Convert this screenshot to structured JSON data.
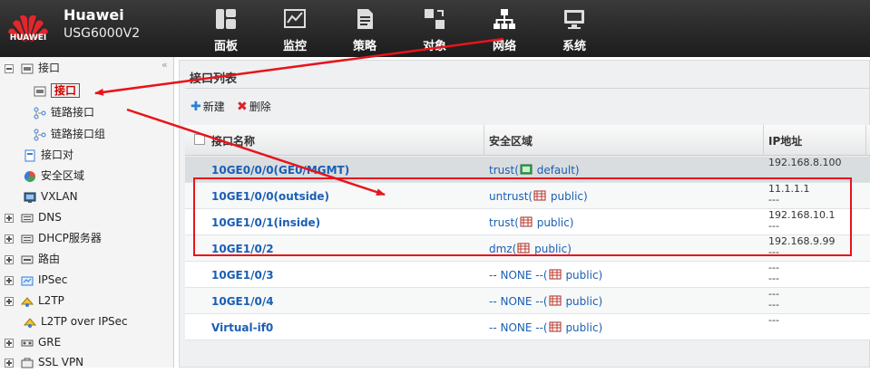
{
  "header": {
    "logo_text": "HUAWEI",
    "brand": "Huawei",
    "model": "USG6000V2",
    "nav": [
      {
        "label": "面板",
        "icon": "dashboard-icon"
      },
      {
        "label": "监控",
        "icon": "monitor-icon"
      },
      {
        "label": "策略",
        "icon": "policy-icon"
      },
      {
        "label": "对象",
        "icon": "object-icon"
      },
      {
        "label": "网络",
        "icon": "network-icon"
      },
      {
        "label": "系统",
        "icon": "system-icon"
      }
    ]
  },
  "sidebar": {
    "collapse_glyph": "«",
    "items": [
      {
        "label": "接口",
        "icon": "interface-icon",
        "expander": "minus"
      },
      {
        "label": "接口",
        "icon": "interface-icon",
        "selected": true
      },
      {
        "label": "链路接口",
        "icon": "link-interface-icon"
      },
      {
        "label": "链路接口组",
        "icon": "link-group-icon"
      },
      {
        "label": "接口对",
        "icon": "interface-pair-icon"
      },
      {
        "label": "安全区域",
        "icon": "security-zone-icon"
      },
      {
        "label": "VXLAN",
        "icon": "vxlan-icon"
      },
      {
        "label": "DNS",
        "icon": "dns-icon",
        "expander": "plus"
      },
      {
        "label": "DHCP服务器",
        "icon": "dhcp-icon",
        "expander": "plus"
      },
      {
        "label": "路由",
        "icon": "route-icon",
        "expander": "plus"
      },
      {
        "label": "IPSec",
        "icon": "ipsec-icon",
        "expander": "plus"
      },
      {
        "label": "L2TP",
        "icon": "l2tp-icon",
        "expander": "plus"
      },
      {
        "label": "L2TP over IPSec",
        "icon": "l2tp-ipsec-icon"
      },
      {
        "label": "GRE",
        "icon": "gre-icon",
        "expander": "plus"
      },
      {
        "label": "SSL VPN",
        "icon": "sslvpn-icon",
        "expander": "plus"
      }
    ]
  },
  "main": {
    "panel_title": "接口列表",
    "toolbar": {
      "new_label": "新建",
      "new_icon": "plus-icon",
      "delete_label": "删除",
      "delete_icon": "delete-icon"
    },
    "columns": [
      "接口名称",
      "安全区域",
      "IP地址"
    ],
    "rows": [
      {
        "name": "10GE0/0/0(GE0/MGMT)",
        "zone_prefix": "trust(",
        "zone_icon": "zone-green-icon",
        "zone_suffix": " default)",
        "ip": [
          "192.168.8.100",
          ""
        ]
      },
      {
        "name": "10GE1/0/0(outside)",
        "zone_prefix": "untrust(",
        "zone_icon": "zone-red-icon",
        "zone_suffix": " public)",
        "ip": [
          "11.1.1.1",
          "---"
        ]
      },
      {
        "name": "10GE1/0/1(inside)",
        "zone_prefix": "trust(",
        "zone_icon": "zone-red-icon",
        "zone_suffix": " public)",
        "ip": [
          "192.168.10.1",
          "---"
        ]
      },
      {
        "name": "10GE1/0/2",
        "zone_prefix": "dmz(",
        "zone_icon": "zone-red-icon",
        "zone_suffix": " public)",
        "ip": [
          "192.168.9.99",
          "---"
        ]
      },
      {
        "name": "10GE1/0/3",
        "zone_prefix": "-- NONE --(",
        "zone_icon": "zone-red-icon",
        "zone_suffix": " public)",
        "ip": [
          "---",
          "---"
        ]
      },
      {
        "name": "10GE1/0/4",
        "zone_prefix": "-- NONE --(",
        "zone_icon": "zone-red-icon",
        "zone_suffix": " public)",
        "ip": [
          "---",
          "---"
        ]
      },
      {
        "name": "Virtual-if0",
        "zone_prefix": "-- NONE --(",
        "zone_icon": "zone-red-icon",
        "zone_suffix": " public)",
        "ip": [
          "---",
          ""
        ]
      }
    ]
  },
  "colors": {
    "annotation": "#e8141b",
    "link": "#1a5fb4",
    "selected_text": "#cc0000"
  }
}
